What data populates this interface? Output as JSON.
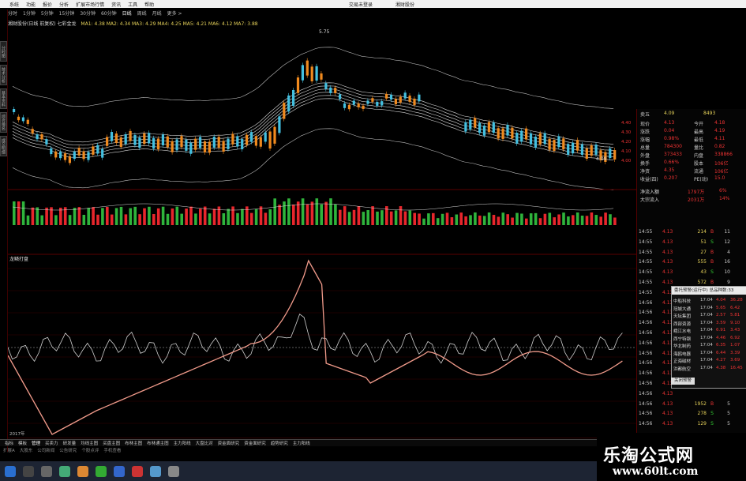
{
  "menubar": {
    "items": [
      "系统",
      "功能",
      "报价",
      "分析",
      "扩展市场行情",
      "资讯",
      "工具",
      "帮助"
    ],
    "right": [
      "交易未登录",
      "湘财股份"
    ]
  },
  "periods": [
    "分时",
    "1分钟",
    "5分钟",
    "15分钟",
    "30分钟",
    "60分钟",
    "日线",
    "周线",
    "月线",
    "更多 >"
  ],
  "indicator_line": {
    "title": "湘财股份(日线 前复权) 七彩金龙",
    "ma": "MA1: 4.38  MA2: 4.34  MA3: 4.29  MA4: 4.25  MA5: 4.21  MA6: 4.12  MA7: 3.88"
  },
  "price_annotations": {
    "high": "5.75",
    "last": "4.09"
  },
  "sub_title": "龙鳞打盘",
  "left_tabs": [
    "分时图",
    "技术分析",
    "基本资料",
    "综合排名",
    "成交明细"
  ],
  "axis_right": [
    "4.40",
    "4.30",
    "4.20",
    "4.10",
    "4.00",
    "3.90"
  ],
  "quote": {
    "title": "卖五",
    "title_val": "4.09",
    "title_vol": "8493",
    "rows": [
      {
        "l": "现价",
        "v": "4.13",
        "l2": "今开",
        "v2": "4.18"
      },
      {
        "l": "涨跌",
        "v": "0.04",
        "l2": "最高",
        "v2": "4.19"
      },
      {
        "l": "涨幅",
        "v": "0.98%",
        "l2": "最低",
        "v2": "4.11"
      },
      {
        "l": "总量",
        "v": "784300",
        "l2": "量比",
        "v2": "0.82"
      },
      {
        "l": "外盘",
        "v": "373433",
        "l2": "内盘",
        "v2": "338866"
      },
      {
        "l": "换手",
        "v": "0.66%",
        "l2": "股本",
        "v2": "106亿"
      },
      {
        "l": "净资",
        "v": "4.35",
        "l2": "流通",
        "v2": "106亿"
      },
      {
        "l": "收益(四)",
        "v": "0.207",
        "l2": "PE(动)",
        "v2": "15.0"
      }
    ],
    "flow": [
      {
        "l": "净流入额",
        "v": "1797万",
        "p": "6%"
      },
      {
        "l": "大宗流入",
        "v": "2031万",
        "p": "14%"
      }
    ]
  },
  "ticks": [
    [
      "14:55",
      "4.13",
      "214",
      "B",
      "11"
    ],
    [
      "14:55",
      "4.13",
      "51",
      "S",
      "12"
    ],
    [
      "14:55",
      "4.13",
      "27",
      "B",
      "4"
    ],
    [
      "14:55",
      "4.13",
      "555",
      "B",
      "16"
    ],
    [
      "14:55",
      "4.13",
      "43",
      "S",
      "10"
    ],
    [
      "14:55",
      "4.13",
      "572",
      "B",
      "9"
    ],
    [
      "14:55",
      "4.13",
      "492",
      "B",
      "6"
    ],
    [
      "14:56",
      "4.13",
      "",
      "",
      ""
    ],
    [
      "14:56",
      "4.13",
      "",
      "",
      ""
    ],
    [
      "14:56",
      "4.13",
      "",
      "",
      ""
    ],
    [
      "14:56",
      "4.13",
      "",
      "",
      ""
    ],
    [
      "14:56",
      "4.13",
      "",
      "",
      ""
    ],
    [
      "14:56",
      "4.13",
      "",
      "",
      ""
    ],
    [
      "14:56",
      "4.13",
      "",
      "",
      ""
    ],
    [
      "14:56",
      "4.13",
      "",
      "",
      ""
    ],
    [
      "14:56",
      "4.13",
      "",
      "",
      ""
    ],
    [
      "14:56",
      "4.13",
      "",
      "",
      ""
    ],
    [
      "14:56",
      "4.13",
      "1952",
      "B",
      "5"
    ],
    [
      "14:56",
      "4.13",
      "278",
      "S",
      "5"
    ],
    [
      "14:56",
      "4.13",
      "129",
      "S",
      "5"
    ]
  ],
  "popup": {
    "header": "委托预警(运行中) 总品种数:33",
    "rows": [
      [
        "中船科技",
        "17:04",
        "4.04",
        "36.28"
      ],
      [
        "冠城大通",
        "17:04",
        "5.65",
        "6.42"
      ],
      [
        "天坛集团",
        "17:04",
        "2.57",
        "5.81"
      ],
      [
        "西部资源",
        "17:04",
        "3.59",
        "9.10"
      ],
      [
        "峨江水电",
        "17:04",
        "6.91",
        "3.43"
      ],
      [
        "西宁特钢",
        "17:04",
        "4.46",
        "6.92"
      ],
      [
        "华北制药",
        "17:04",
        "6.35",
        "1.07"
      ],
      [
        "海鸥电器",
        "17:04",
        "6.44",
        "3.39"
      ],
      [
        "正海磁材",
        "17:04",
        "4.27",
        "3.69"
      ],
      [
        "洪都航空",
        "17:04",
        "4.38",
        "16.45"
      ]
    ],
    "button": "关闭预警"
  },
  "bottom_tabs": [
    "指标",
    "模板",
    "管理",
    "买卖力",
    "研发量",
    "均线主图",
    "买盘主图",
    "布林主图",
    "布林通主图",
    "主力阳线",
    "大盘比对",
    "资金面研究",
    "资金面研究",
    "趋势研究",
    "主力阳线"
  ],
  "status_items": [
    "扩展A",
    "大股东",
    "公司新闻",
    "公告研究",
    "个股点评",
    "手机查看"
  ],
  "year_label": "2017年",
  "watermark": {
    "line1": "乐淘公式网",
    "line2": "www.60lt.com"
  },
  "colors": {
    "up": "#e8262c",
    "down": "#43c0e0",
    "orange": "#f08a1e",
    "salmon": "#f09a8a",
    "cyan": "#4fc4d6"
  }
}
